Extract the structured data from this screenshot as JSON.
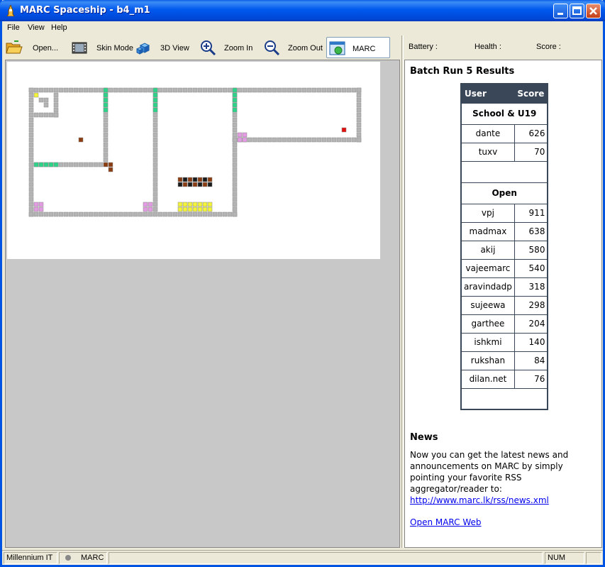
{
  "window": {
    "title": "MARC Spaceship - b4_m1"
  },
  "menu": [
    "File",
    "View",
    "Help"
  ],
  "toolbar": {
    "open": "Open...",
    "skin_mode": "Skin Mode",
    "view_3d": "3D View",
    "zoom_in": "Zoom In",
    "zoom_out": "Zoom Out",
    "marc": "MARC"
  },
  "status_top": {
    "battery": "Battery :",
    "health": "Health :",
    "score": "Score :"
  },
  "results": {
    "title": "Batch Run 5 Results",
    "header": {
      "user": "User",
      "score": "Score"
    },
    "groups": [
      {
        "name": "School & U19",
        "rows": [
          {
            "user": "dante",
            "score": "626"
          },
          {
            "user": "tuxv",
            "score": "70"
          }
        ]
      },
      {
        "name": "Open",
        "rows": [
          {
            "user": "vpj",
            "score": "911"
          },
          {
            "user": "madmax",
            "score": "638"
          },
          {
            "user": "akij",
            "score": "580"
          },
          {
            "user": "vajeemarc",
            "score": "540"
          },
          {
            "user": "aravindadp",
            "score": "318"
          },
          {
            "user": "sujeewa",
            "score": "298"
          },
          {
            "user": "garthee",
            "score": "204"
          },
          {
            "user": "ishkmi",
            "score": "140"
          },
          {
            "user": "rukshan",
            "score": "84"
          },
          {
            "user": "dilan.net",
            "score": "76"
          }
        ]
      }
    ]
  },
  "news": {
    "title": "News",
    "text": "Now you can get the latest news and announcements on MARC by simply pointing your favorite RSS aggregator/reader to:",
    "link": "http://www.marc.lk/rss/news.xml",
    "open_web": "Open MARC Web"
  },
  "statusbar": {
    "company": "Millennium IT",
    "marc": "MARC",
    "num": "NUM"
  },
  "colors": {
    "wall": "#B4B4B4",
    "green": "#2ED38A",
    "pink": "#E39BE3",
    "yellow": "#F3F33A",
    "brown": "#8A3C12",
    "red": "#E01010",
    "black": "#1A1A1A"
  }
}
